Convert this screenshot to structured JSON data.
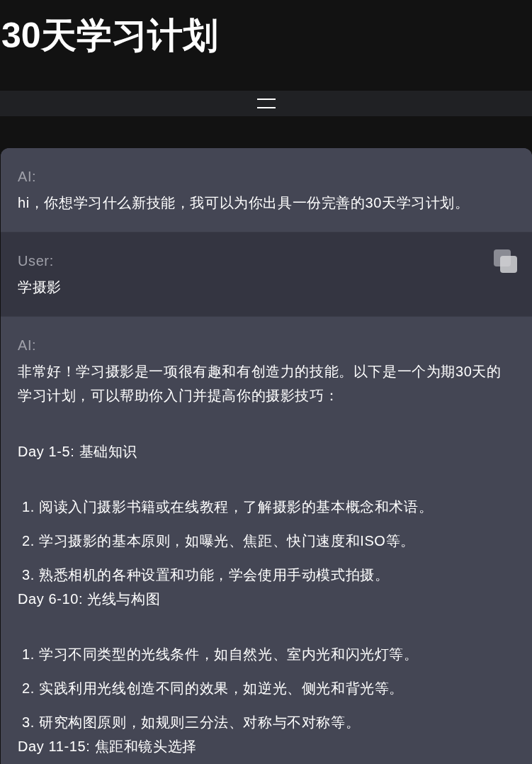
{
  "title": "30天学习计划",
  "messages": [
    {
      "kind": "ai",
      "label": "AI:",
      "show_copy": false,
      "blocks": [
        {
          "kind": "paragraph",
          "text": "hi，你想学习什么新技能，我可以为你出具一份完善的30天学习计划。"
        }
      ]
    },
    {
      "kind": "user",
      "label": "User:",
      "show_copy": true,
      "blocks": [
        {
          "kind": "paragraph",
          "text": "学摄影"
        }
      ]
    },
    {
      "kind": "ai",
      "label": "AI:",
      "show_copy": false,
      "blocks": [
        {
          "kind": "paragraph",
          "text": "非常好！学习摄影是一项很有趣和有创造力的技能。以下是一个为期30天的学习计划，可以帮助你入门并提高你的摄影技巧："
        },
        {
          "kind": "heading",
          "text": "Day 1-5: 基础知识"
        },
        {
          "kind": "list",
          "items": [
            {
              "number": "1.",
              "text": "阅读入门摄影书籍或在线教程，了解摄影的基本概念和术语。"
            },
            {
              "number": "2.",
              "text": "学习摄影的基本原则，如曝光、焦距、快门速度和ISO等。"
            },
            {
              "number": "3.",
              "text": "熟悉相机的各种设置和功能，学会使用手动模式拍摄。"
            }
          ]
        },
        {
          "kind": "heading",
          "text": "Day 6-10: 光线与构图"
        },
        {
          "kind": "list",
          "items": [
            {
              "number": "1.",
              "text": "学习不同类型的光线条件，如自然光、室内光和闪光灯等。"
            },
            {
              "number": "2.",
              "text": "实践利用光线创造不同的效果，如逆光、侧光和背光等。"
            },
            {
              "number": "3.",
              "text": "研究构图原则，如规则三分法、对称与不对称等。"
            }
          ]
        },
        {
          "kind": "heading",
          "text": "Day 11-15: 焦距和镜头选择"
        }
      ]
    }
  ]
}
